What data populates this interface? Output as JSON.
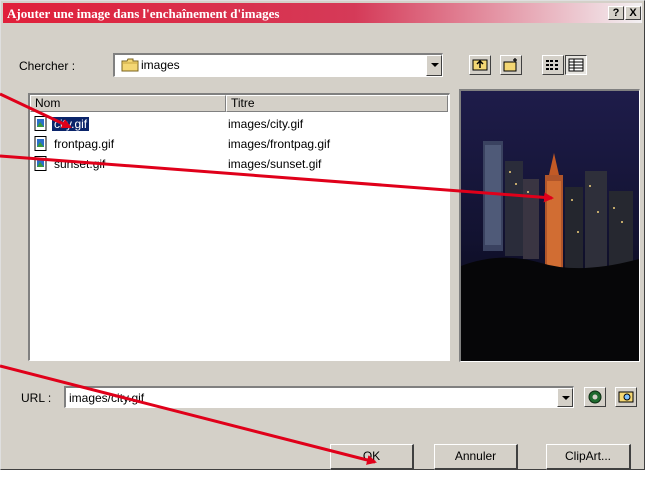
{
  "window": {
    "title": "Ajouter une image dans l'enchaînement d'images",
    "help_label": "?",
    "close_label": "X"
  },
  "search": {
    "label": "Chercher :",
    "folder": "images"
  },
  "list": {
    "columns": [
      "Nom",
      "Titre"
    ],
    "rows": [
      {
        "name": "city.gif",
        "title": "images/city.gif",
        "selected": true
      },
      {
        "name": "frontpag.gif",
        "title": "images/frontpag.gif",
        "selected": false
      },
      {
        "name": "sunset.gif",
        "title": "images/sunset.gif",
        "selected": false
      }
    ]
  },
  "url": {
    "label": "URL :",
    "value": "images/city.gif"
  },
  "buttons": {
    "ok": "OK",
    "cancel": "Annuler",
    "clipart": "ClipArt..."
  },
  "colors": {
    "title_start": "#e0203a",
    "selection": "#0a246a",
    "annotation_arrow": "#e0001a"
  },
  "icons": [
    "folder-icon",
    "up-folder-icon",
    "new-folder-icon",
    "list-view-icon",
    "details-view-icon",
    "browse-web-icon",
    "browse-file-icon",
    "gif-file-icon"
  ]
}
